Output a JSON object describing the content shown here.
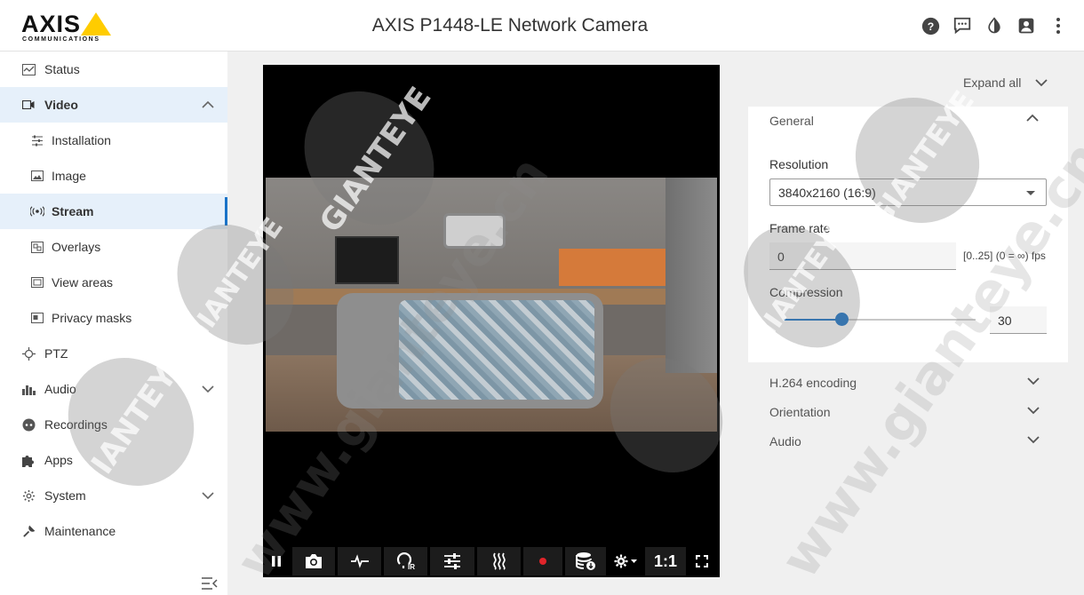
{
  "header": {
    "logo_text": "AXIS",
    "logo_sub": "COMMUNICATIONS",
    "title": "AXIS P1448-LE Network Camera",
    "icons": [
      "help-icon",
      "feedback-icon",
      "contrast-icon",
      "user-icon",
      "more-vert-icon"
    ]
  },
  "sidebar": {
    "items": [
      {
        "label": "Status",
        "icon": "status-icon"
      },
      {
        "label": "Video",
        "icon": "video-icon",
        "expanded": true
      },
      {
        "label": "Installation",
        "icon": "installation-icon"
      },
      {
        "label": "Image",
        "icon": "image-icon"
      },
      {
        "label": "Stream",
        "icon": "stream-icon",
        "selected": true
      },
      {
        "label": "Overlays",
        "icon": "overlays-icon"
      },
      {
        "label": "View areas",
        "icon": "view-areas-icon"
      },
      {
        "label": "Privacy masks",
        "icon": "privacy-masks-icon"
      },
      {
        "label": "PTZ",
        "icon": "ptz-icon"
      },
      {
        "label": "Audio",
        "icon": "audio-icon"
      },
      {
        "label": "Recordings",
        "icon": "recordings-icon"
      },
      {
        "label": "Apps",
        "icon": "apps-icon"
      },
      {
        "label": "System",
        "icon": "system-icon"
      },
      {
        "label": "Maintenance",
        "icon": "maintenance-icon"
      }
    ]
  },
  "player": {
    "zoom_label": "1:1",
    "buttons": [
      "pause-icon",
      "snapshot-icon",
      "pulse-icon",
      "ir-icon",
      "adjust-icon",
      "heat-icon",
      "record-icon",
      "storage-icon",
      "settings-icon",
      "fullscreen-icon"
    ],
    "ir_label": "IR"
  },
  "settings": {
    "expand_all": "Expand all",
    "general": {
      "title": "General",
      "resolution_label": "Resolution",
      "resolution_value": "3840x2160 (16:9)",
      "framerate_label": "Frame rate",
      "framerate_value": "0",
      "framerate_hint": "[0..25] (0 = ∞) fps",
      "compression_label": "Compression",
      "compression_value": "30",
      "compression_fraction": 0.3
    },
    "sections": [
      "H.264 encoding",
      "Orientation",
      "Audio"
    ]
  },
  "watermark": {
    "brand": "GIANTEYE",
    "url": "www.gianteye.cn"
  },
  "colors": {
    "accent": "#1a73c8",
    "logo_yellow": "#ffcc00",
    "selected_bg": "#e6f0fa",
    "record_red": "#e0242a"
  }
}
